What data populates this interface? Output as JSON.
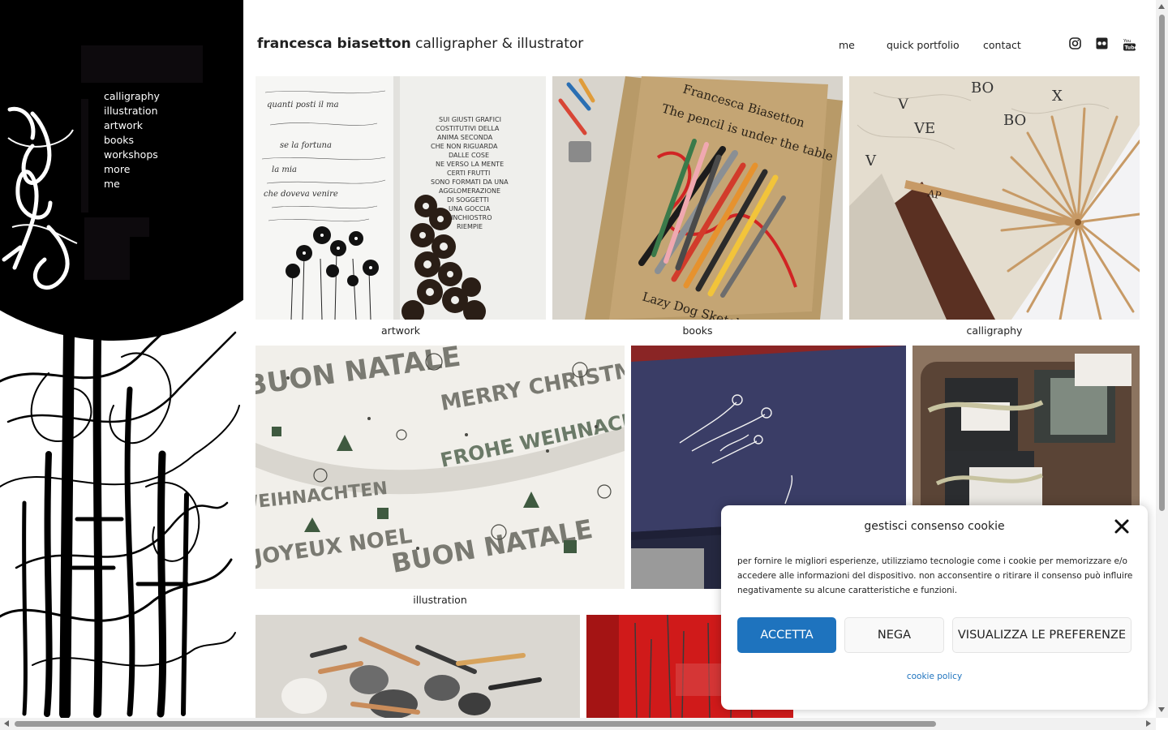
{
  "site": {
    "name": "francesca biasetton",
    "tagline": "calligrapher & illustrator"
  },
  "side_menu": [
    "calligraphy",
    "illustration",
    "artwork",
    "books",
    "workshops",
    "more",
    "me"
  ],
  "top_nav": [
    "me",
    "quick portfolio",
    "contact"
  ],
  "social_icons": [
    "instagram-icon",
    "flickr-icon",
    "youtube-icon"
  ],
  "tiles": {
    "artwork": {
      "caption": "artwork"
    },
    "books": {
      "caption": "books"
    },
    "calligraphy": {
      "caption": "calligraphy"
    },
    "illustration": {
      "caption": "illustration"
    }
  },
  "tile_art": {
    "left_panel_text": [
      "quanti posti il ma",
      "se la fortuna",
      "la mia",
      "che doveva venire"
    ],
    "right_panel_text": [
      "SUI GIUSTI GRAFICI",
      "COSTITUTIVI DELLA",
      "ANIMA SECONDA",
      "CHE NON RIGUARDA",
      "DALLE COSE",
      "NE VERSO LA MENTE",
      "CERTI FRUTTI",
      "SONO FORMATI DA UNA",
      "AGGLOMERAZIONE",
      "DI SOGGETTI",
      "UNA GOCCIA",
      "DI INCHIOSTRO",
      "RIEMPIE"
    ],
    "book_cover_lines": [
      "Francesca Biasetton",
      "The pencil is under the table"
    ],
    "book_bottom": "Lazy Dog Sketch",
    "fan_initials": "AP",
    "wrapping_words": [
      "BUON NATALE",
      "MERRY CHRISTMAS",
      "FROHE WEIHNACHTEN",
      "JOYEUX NOEL",
      "BUON NATALE",
      "WEIHNACHTEN"
    ]
  },
  "cookie": {
    "title": "gestisci consenso cookie",
    "message": "per fornire le migliori esperienze, utilizziamo tecnologie come i cookie per memorizzare e/o accedere alle informazioni del dispositivo. non acconsentire o ritirare il consenso può influire negativamente su alcune caratteristiche e funzioni.",
    "accept": "ACCETTA",
    "deny": "NEGA",
    "preferences": "VISUALIZZA LE PREFERENZE",
    "policy_link": "cookie policy"
  },
  "colors": {
    "accent": "#1e73be",
    "sidebar_bg": "#000000",
    "text": "#222222"
  }
}
